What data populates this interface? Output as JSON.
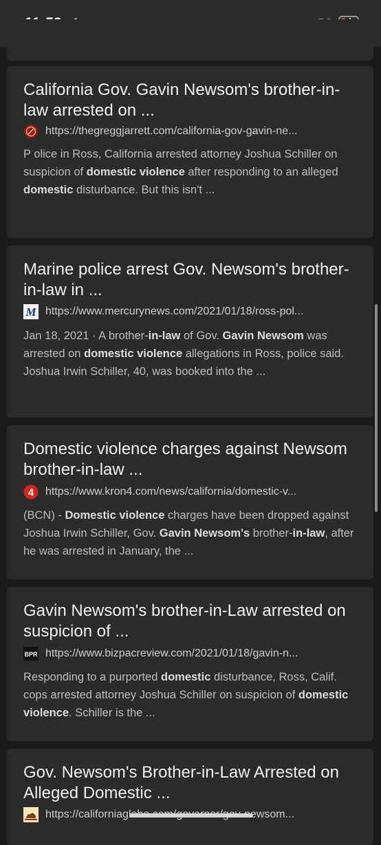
{
  "status": {
    "time": "11:59",
    "network": "5G"
  },
  "results": [
    {
      "title": "California Gov. Gavin Newsom's brother-in-law arrested on ...",
      "url": "https://thegreggjarrett.com/california-gov-gavin-ne...",
      "favicon": "gregg-jarrett-icon",
      "snippet_parts": [
        {
          "t": "P olice in Ross, California arrested attorney Joshua Schiller on suspicion of ",
          "b": false
        },
        {
          "t": "domestic violence",
          "b": true
        },
        {
          "t": " after responding to an alleged ",
          "b": false
        },
        {
          "t": "domestic",
          "b": true
        },
        {
          "t": " disturbance. But this isn't ...",
          "b": false
        }
      ]
    },
    {
      "title": "Marine police arrest Gov. Newsom's brother-in-law in ...",
      "url": "https://www.mercurynews.com/2021/01/18/ross-pol...",
      "favicon": "mercury-news-icon",
      "snippet_parts": [
        {
          "t": "Jan 18, 2021 · ",
          "b": false
        },
        {
          "t": "A brother-",
          "b": false
        },
        {
          "t": "in-law",
          "b": true
        },
        {
          "t": " of Gov. ",
          "b": false
        },
        {
          "t": "Gavin Newsom",
          "b": true
        },
        {
          "t": " was arrested on ",
          "b": false
        },
        {
          "t": "domestic violence",
          "b": true
        },
        {
          "t": " allegations in Ross, police said. Joshua Irwin Schiller, 40, was booked into the ...",
          "b": false
        }
      ]
    },
    {
      "title": "Domestic violence charges against Newsom brother-in-law ...",
      "url": "https://www.kron4.com/news/california/domestic-v...",
      "favicon": "kron4-icon",
      "snippet_parts": [
        {
          "t": "(BCN) - ",
          "b": false
        },
        {
          "t": "Domestic violence",
          "b": true
        },
        {
          "t": " charges have been dropped against Joshua Irwin Schiller, Gov. ",
          "b": false
        },
        {
          "t": "Gavin Newsom's",
          "b": true
        },
        {
          "t": " brother-",
          "b": false
        },
        {
          "t": "in-law",
          "b": true
        },
        {
          "t": ", after he was arrested in January, the ...",
          "b": false
        }
      ]
    },
    {
      "title": "Gavin Newsom's brother-in-Law arrested on suspicion of ...",
      "url": "https://www.bizpacreview.com/2021/01/18/gavin-n...",
      "favicon": "bpr-icon",
      "favicon_text": "BPR",
      "snippet_parts": [
        {
          "t": "Responding to a purported ",
          "b": false
        },
        {
          "t": "domestic",
          "b": true
        },
        {
          "t": " disturbance, Ross, Calif. cops arrested attorney Joshua Schiller on suspicion of ",
          "b": false
        },
        {
          "t": "domestic violence",
          "b": true
        },
        {
          "t": ". Schiller is the ...",
          "b": false
        }
      ]
    },
    {
      "title": "Gov. Newsom's Brother-in-Law Arrested on Alleged Domestic ...",
      "url": "https://californiaglobe.com/governor/gov-newsom...",
      "favicon": "california-globe-icon"
    }
  ]
}
